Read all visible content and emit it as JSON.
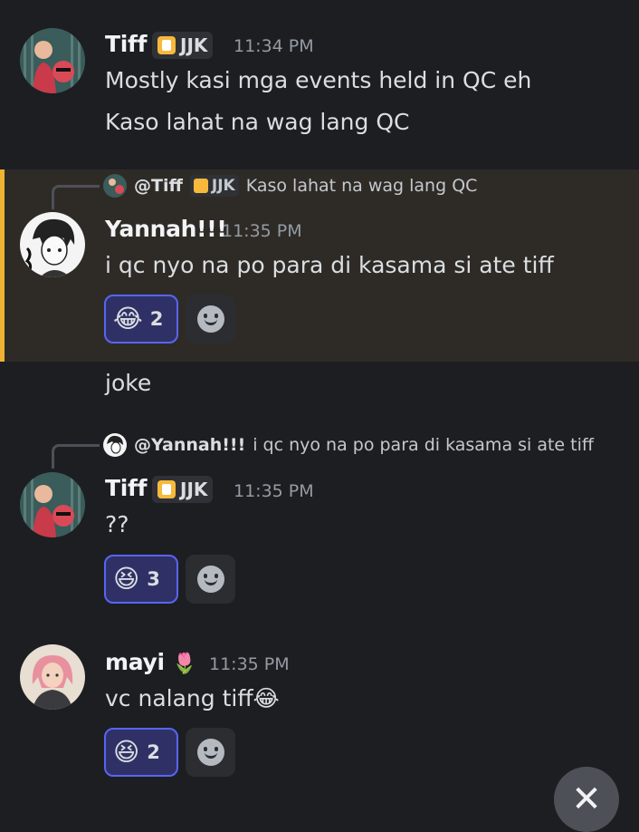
{
  "messages": [
    {
      "username": "Tiff",
      "tag": "JJK",
      "time": "11:34 PM",
      "lines": [
        "Mostly kasi mga events held in QC eh",
        "Kaso lahat na wag lang QC"
      ]
    },
    {
      "reply": {
        "name": "@Tiff",
        "tag": "JJK",
        "text": "Kaso lahat na wag lang QC"
      },
      "username": "Yannah!!!",
      "time": "11:35 PM",
      "lines": [
        "i qc nyo na po para di kasama si ate tiff"
      ],
      "reaction": {
        "emoji": "😂",
        "count": "2"
      }
    },
    {
      "lines": [
        "joke"
      ]
    },
    {
      "reply": {
        "name": "@Yannah!!!",
        "text": "i qc nyo na po para di kasama si ate tiff"
      },
      "username": "Tiff",
      "tag": "JJK",
      "time": "11:35 PM",
      "lines": [
        "??"
      ],
      "reaction": {
        "emoji": "😆",
        "count": "3"
      }
    },
    {
      "username": "mayi",
      "name_emoji": "🌷",
      "time": "11:35 PM",
      "lines": [
        "vc nalang tiff😂"
      ],
      "reaction": {
        "emoji": "😆",
        "count": "2"
      }
    }
  ],
  "close_icon": "✕"
}
